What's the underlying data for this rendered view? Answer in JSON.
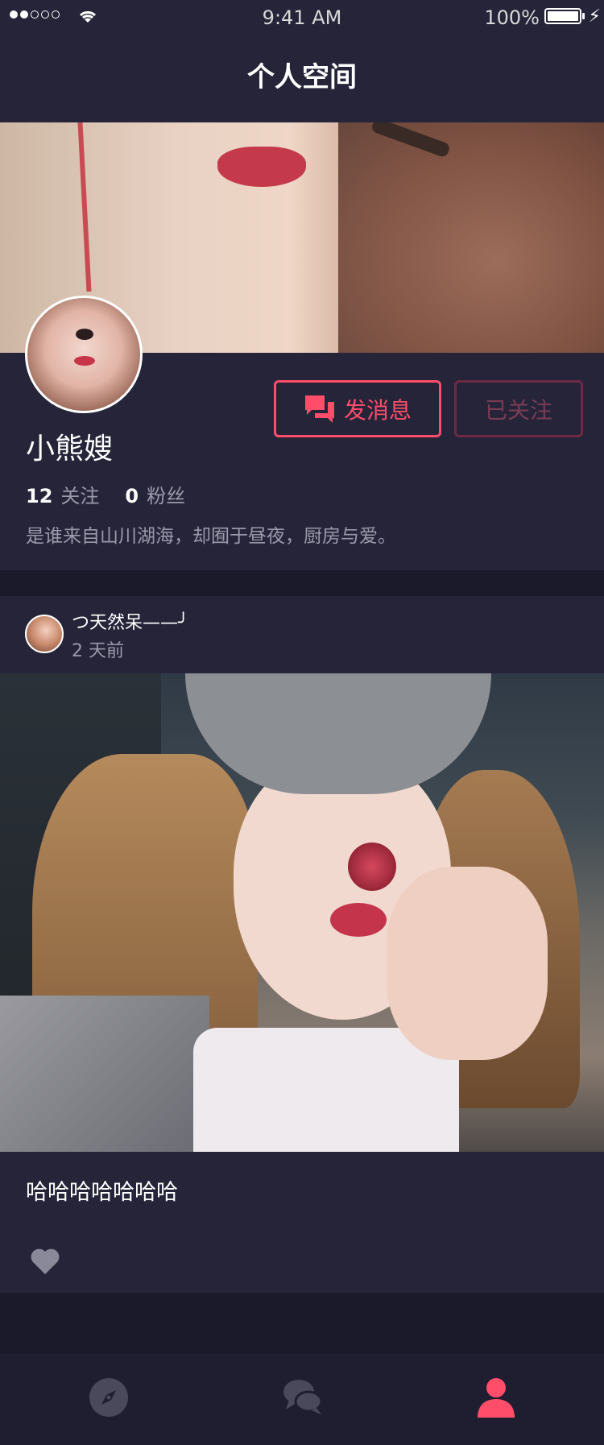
{
  "status_bar": {
    "time": "9:41 AM",
    "battery": "100%"
  },
  "header": {
    "title": "个人空间"
  },
  "profile": {
    "username": "小熊嫂",
    "following_count": "12",
    "following_label": "关注",
    "followers_count": "0",
    "followers_label": "粉丝",
    "bio": "是谁来自山川湖海，却囿于昼夜，厨房与爱。",
    "message_button": "发消息",
    "follow_button": "已关注"
  },
  "post": {
    "author": "つ天然呆——╯",
    "time": "2 天前",
    "text": "哈哈哈哈哈哈哈"
  },
  "tabbar": {
    "tabs": [
      "discover",
      "messages",
      "profile"
    ],
    "active": "profile"
  },
  "colors": {
    "accent": "#ff4d6a",
    "background": "#1b1a2b",
    "card": "#252439",
    "muted": "#9b9aab"
  },
  "icons": [
    "wifi-icon",
    "battery-icon",
    "chat-icon",
    "heart-icon",
    "compass-icon",
    "messages-icon",
    "user-icon"
  ]
}
